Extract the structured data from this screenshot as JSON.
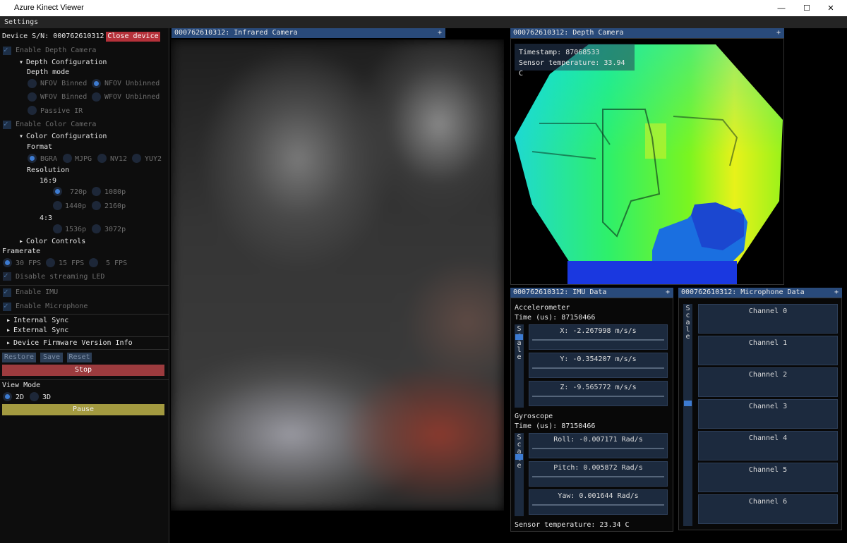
{
  "window": {
    "title": "Azure Kinect Viewer",
    "minimize": "—",
    "maximize": "☐",
    "close": "✕"
  },
  "menu": {
    "settings": "Settings"
  },
  "device": {
    "sn_label": "Device S/N: 000762610312",
    "close_button": "Close device"
  },
  "depth": {
    "enable_label": "Enable Depth Camera",
    "config_label": "Depth Configuration",
    "mode_label": "Depth mode",
    "modes": [
      "NFOV Binned",
      "NFOV Unbinned",
      "WFOV Binned",
      "WFOV Unbinned",
      "Passive IR"
    ],
    "selected_mode": "NFOV Unbinned"
  },
  "color": {
    "enable_label": "Enable Color Camera",
    "config_label": "Color Configuration",
    "format_label": "Format",
    "formats": [
      "BGRA",
      "MJPG",
      "NV12",
      "YUY2"
    ],
    "resolution_label": "Resolution",
    "ratio_169": "16:9",
    "res_169": [
      "720p",
      "1080p",
      "1440p",
      "2160p"
    ],
    "ratio_43": "4:3",
    "res_43": [
      "1536p",
      "3072p"
    ],
    "controls_label": "Color Controls"
  },
  "framerate": {
    "label": "Framerate",
    "options": [
      "30 FPS",
      "15 FPS",
      "5 FPS"
    ]
  },
  "led": {
    "label": "Disable streaming LED"
  },
  "imu_toggle": {
    "label": "Enable IMU"
  },
  "mic_toggle": {
    "label": "Enable Microphone"
  },
  "sync": {
    "internal": "Internal Sync",
    "external": "External Sync"
  },
  "firmware": {
    "label": "Device Firmware Version Info"
  },
  "actions": {
    "restore": "Restore",
    "save": "Save",
    "reset": "Reset",
    "stop": "Stop"
  },
  "view_mode": {
    "label": "View Mode",
    "options": [
      "2D",
      "3D"
    ],
    "pause": "Pause"
  },
  "panes": {
    "ir_title": "000762610312: Infrared Camera",
    "depth_title": "000762610312: Depth Camera",
    "imu_title": "000762610312: IMU Data",
    "mic_title": "000762610312: Microphone Data",
    "plus": "+"
  },
  "depth_info": {
    "timestamp": "Timestamp: 87068533",
    "temperature": "Sensor temperature: 33.94 C"
  },
  "imu": {
    "accel_label": "Accelerometer",
    "accel_time": "Time (us): 87150466",
    "accel": [
      "X:   -2.267998 m/s/s",
      "Y:   -0.354207 m/s/s",
      "Z:   -9.565772 m/s/s"
    ],
    "gyro_label": "Gyroscope",
    "gyro_time": "Time (us): 87150466",
    "gyro": [
      "Roll:   -0.007171 Rad/s",
      "Pitch:   0.005872 Rad/s",
      "Yaw:   0.001644 Rad/s"
    ],
    "scale": [
      "S",
      "c",
      "a",
      "l",
      "e"
    ],
    "sensor_temp": "Sensor temperature: 23.34 C"
  },
  "mic": {
    "scale": [
      "S",
      "c",
      "a",
      "l",
      "e"
    ],
    "channels": [
      "Channel 0",
      "Channel 1",
      "Channel 2",
      "Channel 3",
      "Channel 4",
      "Channel 5",
      "Channel 6"
    ]
  }
}
